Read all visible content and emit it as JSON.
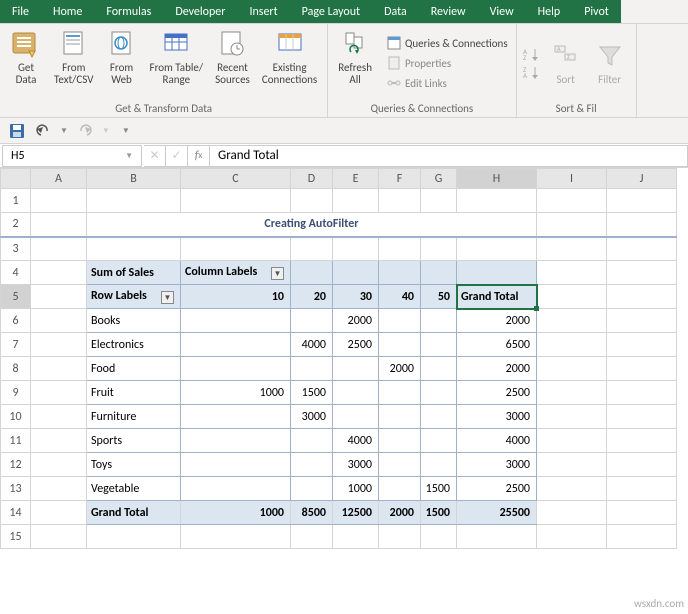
{
  "tabs": [
    "File",
    "Home",
    "Formulas",
    "Developer",
    "Insert",
    "Page Layout",
    "Data",
    "Review",
    "View",
    "Help",
    "Pivot"
  ],
  "active_tab": "Data",
  "ribbon": {
    "group1_label": "Get & Transform Data",
    "get_data": "Get\nData",
    "from_csv": "From\nText/CSV",
    "from_web": "From\nWeb",
    "from_table": "From Table/\nRange",
    "recent": "Recent\nSources",
    "existing": "Existing\nConnections",
    "refresh": "Refresh\nAll",
    "queries": "Queries & Connections",
    "properties": "Properties",
    "editlinks": "Edit Links",
    "group2_label": "Queries & Connections",
    "sort": "Sort",
    "filter": "Filter",
    "group3_label": "Sort & Fil"
  },
  "namebox": "H5",
  "formula": "Grand Total",
  "cols": [
    "A",
    "B",
    "C",
    "D",
    "E",
    "F",
    "G",
    "H",
    "I",
    "J"
  ],
  "rows": [
    "1",
    "2",
    "3",
    "4",
    "5",
    "6",
    "7",
    "8",
    "9",
    "10",
    "11",
    "12",
    "13",
    "14",
    "15"
  ],
  "pivot": {
    "title": "Creating AutoFilter",
    "sum_of_sales": "Sum of Sales",
    "column_labels": "Column Labels",
    "row_labels": "Row Labels",
    "grand_total": "Grand Total",
    "col_vals": [
      "10",
      "20",
      "30",
      "40",
      "50"
    ],
    "data": [
      {
        "label": "Books",
        "v": [
          "",
          "",
          "2000",
          "",
          ""
        ],
        "t": "2000"
      },
      {
        "label": "Electronics",
        "v": [
          "",
          "4000",
          "2500",
          "",
          ""
        ],
        "t": "6500"
      },
      {
        "label": "Food",
        "v": [
          "",
          "",
          "",
          "2000",
          ""
        ],
        "t": "2000"
      },
      {
        "label": "Fruit",
        "v": [
          "1000",
          "1500",
          "",
          "",
          ""
        ],
        "t": "2500"
      },
      {
        "label": "Furniture",
        "v": [
          "",
          "3000",
          "",
          "",
          ""
        ],
        "t": "3000"
      },
      {
        "label": "Sports",
        "v": [
          "",
          "",
          "4000",
          "",
          ""
        ],
        "t": "4000"
      },
      {
        "label": "Toys",
        "v": [
          "",
          "",
          "3000",
          "",
          ""
        ],
        "t": "3000"
      },
      {
        "label": "Vegetable",
        "v": [
          "",
          "",
          "1000",
          "",
          "1500"
        ],
        "t": "2500"
      }
    ],
    "grand_row": [
      "1000",
      "8500",
      "12500",
      "2000",
      "1500"
    ],
    "grand_total_val": "25500"
  },
  "watermark": "wsxdn.com"
}
